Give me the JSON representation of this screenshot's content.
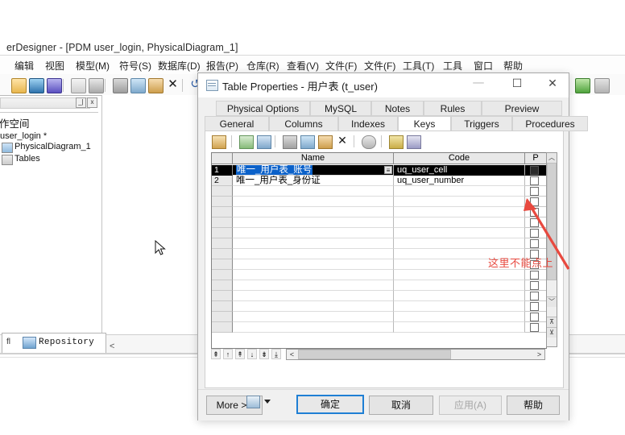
{
  "window": {
    "app_title": "erDesigner - [PDM user_login, PhysicalDiagram_1]",
    "menu": [
      "编辑",
      "视图",
      "模型(M)",
      "符号(S)",
      "数据库(D)",
      "报告(P)",
      "仓库(R)",
      "查看(V)",
      "文件(F)",
      "文件(F)",
      "工具(T)",
      "工具",
      "窗口",
      "帮助"
    ],
    "toolbar_icons": [
      "open-folder-icon",
      "save-icon",
      "save-all-icon",
      "print-preview-icon",
      "print-icon",
      "cut-icon",
      "copy-icon",
      "paste-icon",
      "delete-icon",
      "undo-icon"
    ],
    "right_icons": [
      "check-model-icon",
      "generate-icon"
    ]
  },
  "tree": {
    "workspace_label": "作空间",
    "collapse_label": "_|",
    "close_label": "x",
    "items": [
      {
        "label": "user_login *",
        "icon": "none"
      },
      {
        "label": "PhysicalDiagram_1",
        "icon": "diagram-icon"
      },
      {
        "label": "Tables",
        "icon": "folder-icon"
      }
    ]
  },
  "statusbar": {
    "repository_label": "Repository",
    "left_glyph": "fl",
    "chevron": "<"
  },
  "dialog": {
    "title": "Table Properties - 用户表 (t_user)",
    "icon": "table-window-icon",
    "window_buttons": {
      "minimize": "—",
      "maximize": "☐",
      "close": "✕"
    },
    "tabs_row1": [
      "Physical Options",
      "MySQL",
      "Notes",
      "Rules",
      "Preview"
    ],
    "tabs_row2": [
      "General",
      "Columns",
      "Indexes",
      "Keys",
      "Triggers",
      "Procedures"
    ],
    "active_tab": "Keys",
    "grid_toolbar_icons": [
      "properties-icon",
      "insert-row-icon",
      "add-row-icon",
      "cut-icon",
      "copy-icon",
      "paste-icon",
      "delete-icon",
      "find-icon",
      "include-icon",
      "exclude-icon"
    ],
    "grid": {
      "columns": [
        "Name",
        "Code",
        "P"
      ],
      "rows": [
        {
          "n": "1",
          "name": "唯一_用户表_账号",
          "code": "uq_user_cell",
          "p": false,
          "selected": true
        },
        {
          "n": "2",
          "name": "唯一_用户表_身份证",
          "code": "uq_user_number",
          "p": false,
          "selected": false
        }
      ],
      "empty_row_count": 14
    },
    "row_tools": [
      "⇞",
      "↑",
      "↟",
      "↓",
      "⇟",
      "⤓"
    ],
    "scroll": {
      "up": "︿",
      "down": "﹀",
      "top_page": "⊼",
      "bottom_page": "⊻",
      "left": "<",
      "right": ">"
    },
    "footer_buttons": {
      "more": "More >>",
      "print": "print-icon",
      "print_caret": "caret-down-icon",
      "ok": "确定",
      "cancel": "取消",
      "apply": "应用(A)",
      "help": "帮助"
    }
  },
  "annotation": {
    "text": "这里不能点上",
    "color": "#e8493f",
    "arrow": "arrow-pointing-up-left"
  }
}
